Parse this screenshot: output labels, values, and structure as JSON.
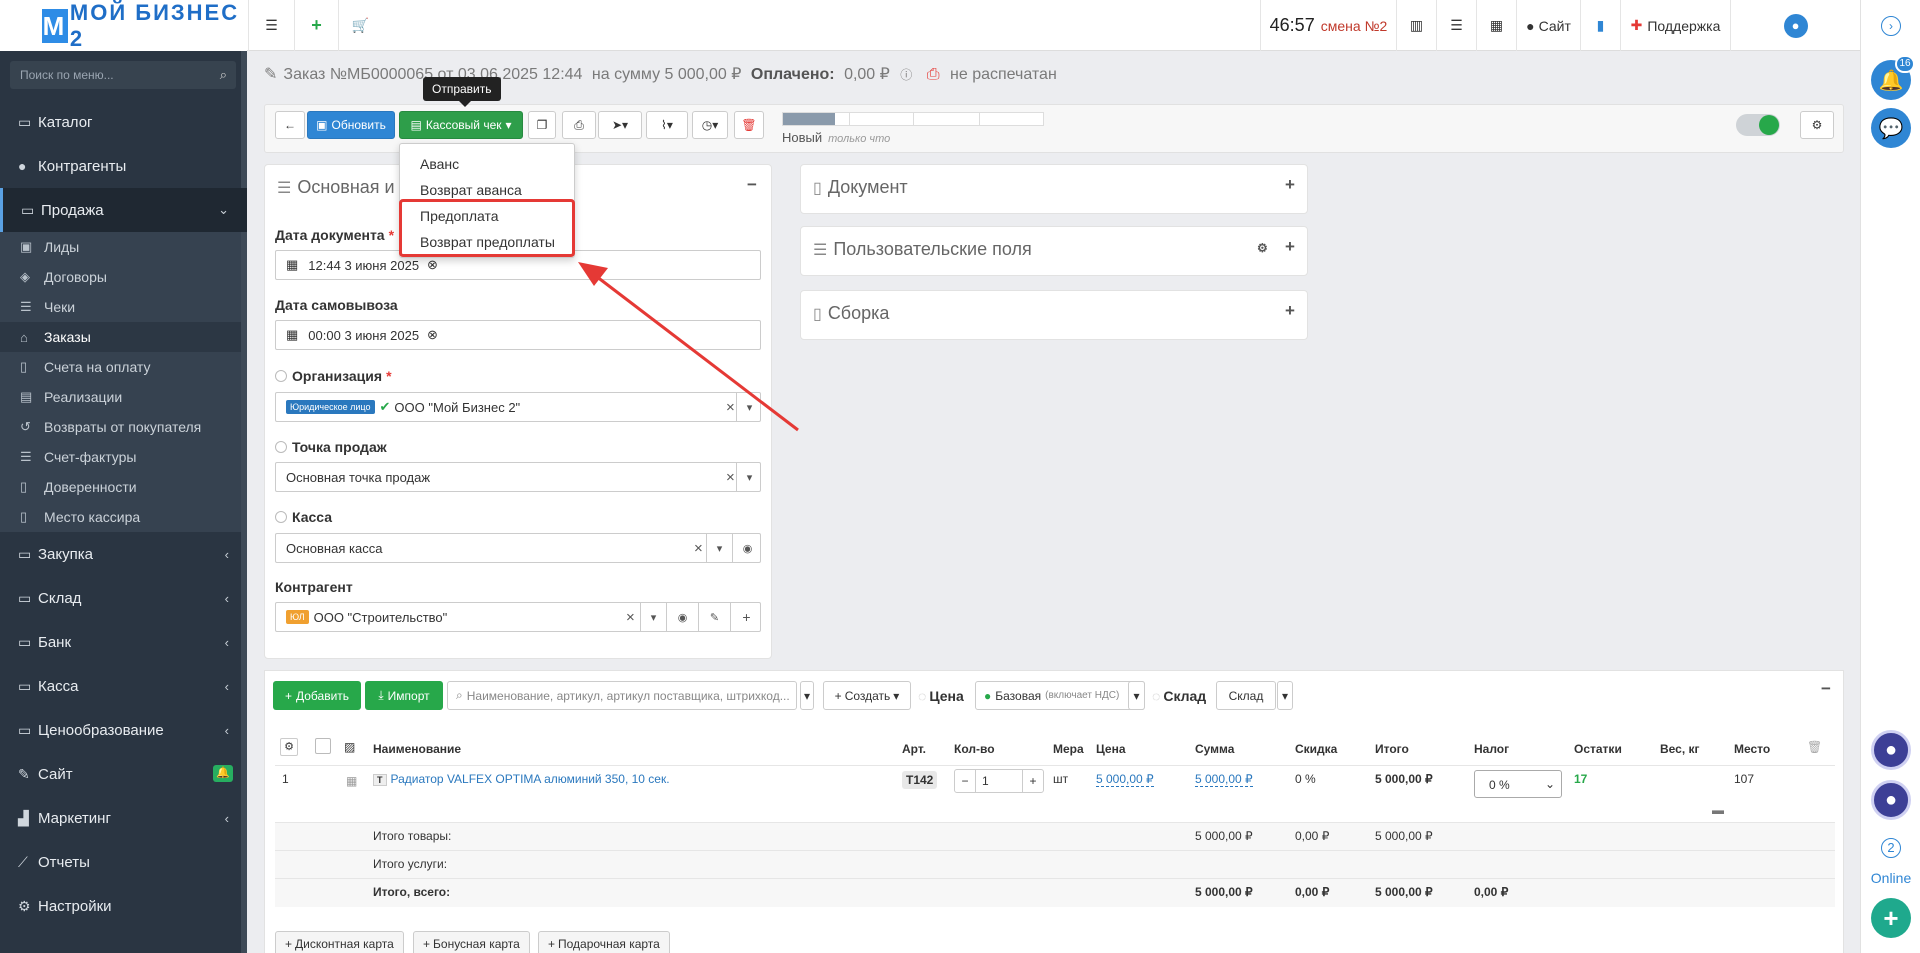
{
  "header": {
    "logo_text": "МОЙ БИЗНЕС 2",
    "timer": "46:57",
    "shift": "смена №2",
    "site_label": "Сайт",
    "support_label": "Поддержка"
  },
  "sidebar": {
    "search_placeholder": "Поиск по меню...",
    "items": [
      {
        "label": "Каталог",
        "icon": "folder-icon"
      },
      {
        "label": "Контрагенты",
        "icon": "users-icon"
      },
      {
        "label": "Продажа",
        "icon": "folder-icon",
        "expanded": true
      },
      {
        "label": "Закупка",
        "icon": "folder-icon"
      },
      {
        "label": "Склад",
        "icon": "folder-icon"
      },
      {
        "label": "Банк",
        "icon": "folder-icon"
      },
      {
        "label": "Касса",
        "icon": "folder-icon"
      },
      {
        "label": "Ценообразование",
        "icon": "folder-icon"
      },
      {
        "label": "Сайт",
        "icon": "magic-icon",
        "badge": "🔔"
      },
      {
        "label": "Маркетинг",
        "icon": "chart-icon"
      },
      {
        "label": "Отчеты",
        "icon": "line-chart-icon"
      },
      {
        "label": "Настройки",
        "icon": "gear-icon"
      }
    ],
    "sub_items": [
      "Лиды",
      "Договоры",
      "Чеки",
      "Заказы",
      "Счета на оплату",
      "Реализации",
      "Возвраты от покупателя",
      "Счет-фактуры",
      "Доверенности",
      "Место кассира"
    ]
  },
  "rail": {
    "notif_count": "16",
    "online_count": "2",
    "online_label": "Online"
  },
  "order": {
    "title": "Заказ №МБ0000065 от 03.06.2025 12:44",
    "sum_text": "на сумму 5 000,00 ₽",
    "paid_label": "Оплачено:",
    "paid_value": "0,00 ₽",
    "print_status": "не распечатан",
    "tooltip": "Отправить",
    "status": "Новый",
    "status_sub": "только что",
    "progress": 0.2
  },
  "toolbar": {
    "refresh": "Обновить",
    "receipt": "Кассовый чек"
  },
  "receipt_menu": {
    "items": [
      "Аванс",
      "Возврат аванса",
      "Предоплата",
      "Возврат предоплаты"
    ]
  },
  "main_panel": {
    "title": "Основная и",
    "date_doc_label": "Дата документа",
    "date_doc_value": "12:44 3 июня 2025",
    "pickup_label": "Дата самовывоза",
    "pickup_value": "00:00 3 июня 2025",
    "org_label": "Организация",
    "org_tag": "Юридическое лицо",
    "org_value": "ООО \"Мой Бизнес 2\"",
    "point_label": "Точка продаж",
    "point_value": "Основная точка продаж",
    "cash_label": "Касса",
    "cash_value": "Основная касса",
    "contr_label": "Контрагент",
    "contr_tag": "ЮЛ",
    "contr_value": "ООО \"Строительство\""
  },
  "side_panels": {
    "document": "Документ",
    "custom_fields": "Пользовательские поля",
    "assembly": "Сборка"
  },
  "products": {
    "add": "Добавить",
    "import": "Импорт",
    "search_placeholder": "Наименование, артикул, артикул поставщика, штрихкод...",
    "create": "Создать",
    "price_label": "Цена",
    "price_type": "Базовая",
    "price_note": "(включает НДС)",
    "warehouse_label": "Склад",
    "warehouse_value": "Склад",
    "columns": [
      "Наименование",
      "Арт.",
      "Кол-во",
      "Мера",
      "Цена",
      "Сумма",
      "Скидка",
      "Итого",
      "Налог",
      "Остатки",
      "Вес, кг",
      "Место"
    ],
    "rows": [
      {
        "num": "1",
        "type": "Т",
        "name": "Радиатор VALFEX OPTIMA алюминий 350, 10 сек.",
        "art": "Т142",
        "qty": "1",
        "unit": "шт",
        "price": "5 000,00 ₽",
        "sum": "5 000,00 ₽",
        "discount": "0 %",
        "total": "5 000,00 ₽",
        "tax": "0 %",
        "stock": "17",
        "place": "107"
      }
    ],
    "totals": [
      {
        "label": "Итого товары:",
        "sum": "5 000,00 ₽",
        "discount": "0,00 ₽",
        "total": "5 000,00 ₽",
        "tax": ""
      },
      {
        "label": "Итого услуги:",
        "sum": "",
        "discount": "",
        "total": "",
        "tax": ""
      },
      {
        "label": "Итого, всего:",
        "sum": "5 000,00 ₽",
        "discount": "0,00 ₽",
        "total": "5 000,00 ₽",
        "tax": "0,00 ₽"
      }
    ]
  },
  "cards": {
    "discount": "Дисконтная карта",
    "bonus": "Бонусная карта",
    "gift": "Подарочная карта"
  }
}
